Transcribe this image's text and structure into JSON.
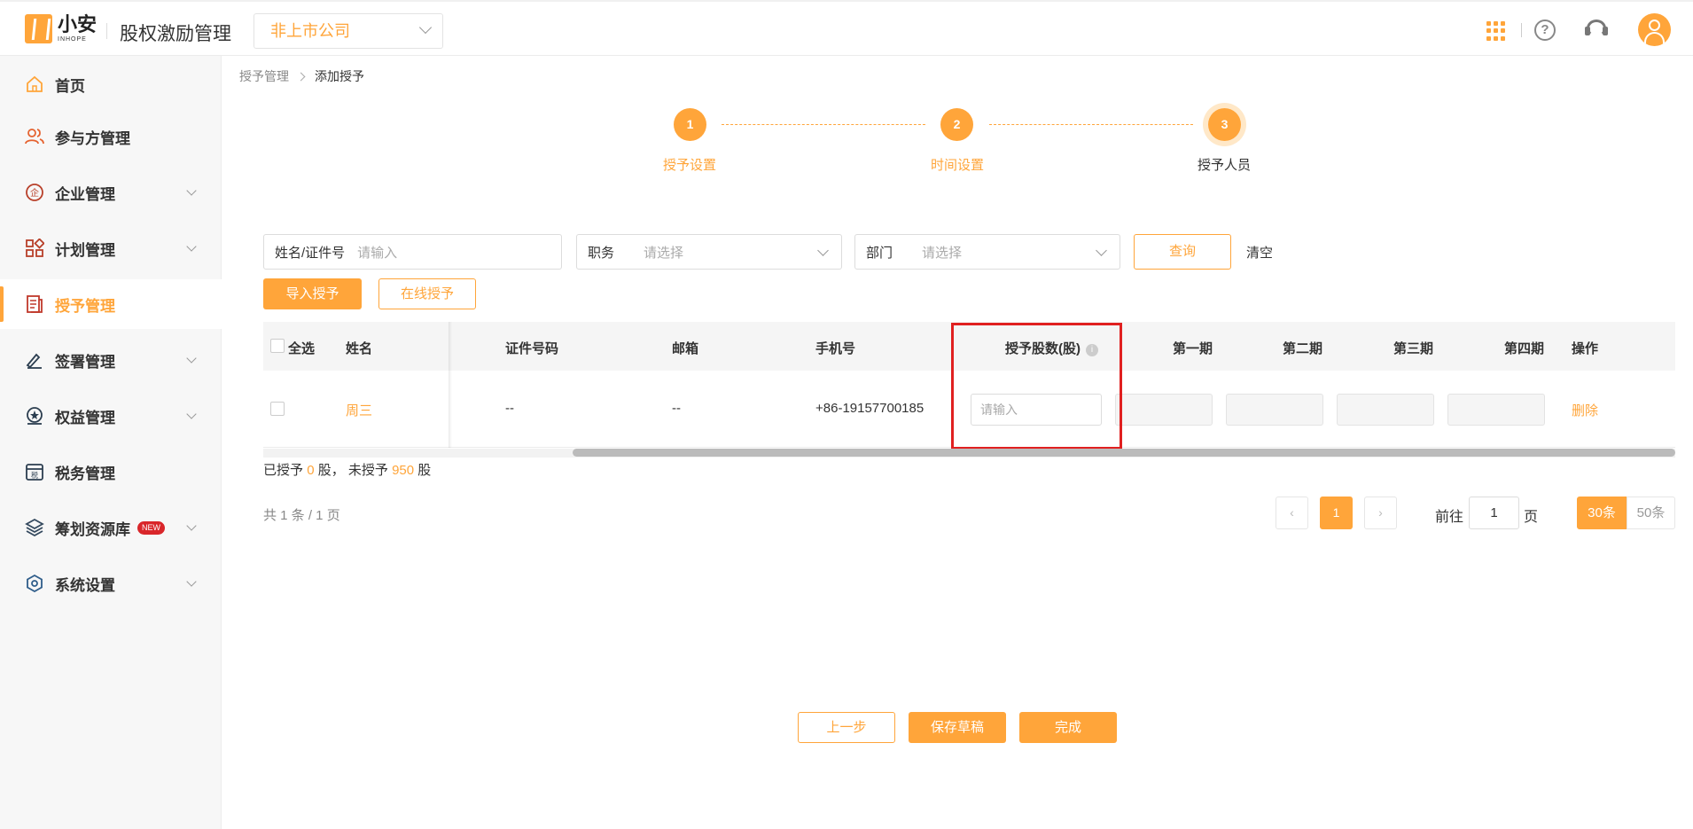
{
  "header": {
    "logo_cn": "小安",
    "logo_en": "INHOPE",
    "app_title": "股权激励管理",
    "company_select": "非上市公司"
  },
  "sidebar": {
    "items": [
      {
        "label": "首页",
        "icon": "home-icon"
      },
      {
        "label": "参与方管理",
        "icon": "users-icon"
      },
      {
        "label": "企业管理",
        "icon": "enterprise-icon"
      },
      {
        "label": "计划管理",
        "icon": "plan-icon"
      },
      {
        "label": "授予管理",
        "icon": "grant-icon"
      },
      {
        "label": "签署管理",
        "icon": "sign-icon"
      },
      {
        "label": "权益管理",
        "icon": "equity-icon"
      },
      {
        "label": "税务管理",
        "icon": "tax-icon"
      },
      {
        "label": "筹划资源库",
        "icon": "layers-icon",
        "badge": "NEW"
      },
      {
        "label": "系统设置",
        "icon": "settings-icon"
      }
    ]
  },
  "breadcrumb": {
    "parent": "授予管理",
    "current": "添加授予"
  },
  "steps": [
    {
      "num": "1",
      "label": "授予设置"
    },
    {
      "num": "2",
      "label": "时间设置"
    },
    {
      "num": "3",
      "label": "授予人员"
    }
  ],
  "filters": {
    "name_label": "姓名/证件号",
    "name_placeholder": "请输入",
    "position_label": "职务",
    "position_placeholder": "请选择",
    "dept_label": "部门",
    "dept_placeholder": "请选择",
    "query_button": "查询",
    "clear_link": "清空"
  },
  "actions": {
    "import_button": "导入授予",
    "online_button": "在线授予"
  },
  "table": {
    "columns": {
      "select_all": "全选",
      "name": "姓名",
      "id_number": "证件号码",
      "email": "邮箱",
      "phone": "手机号",
      "shares": "授予股数(股)",
      "period1": "第一期",
      "period2": "第二期",
      "period3": "第三期",
      "period4": "第四期",
      "operation": "操作"
    },
    "rows": [
      {
        "name": "周三",
        "id_number": "--",
        "email": "--",
        "phone": "+86-19157700185",
        "shares_placeholder": "请输入",
        "operation": "删除"
      }
    ]
  },
  "summary": {
    "granted_prefix": "已授予",
    "granted_value": "0",
    "granted_unit": "股，",
    "ungranted_prefix": "未授予",
    "ungranted_value": "950",
    "ungranted_unit": "股"
  },
  "pagination": {
    "total_text": "共 1 条 / 1 页",
    "current_page": "1",
    "goto_label": "前往",
    "goto_value": "1",
    "page_unit": "页",
    "size_30": "30条",
    "size_50": "50条"
  },
  "footer": {
    "prev_button": "上一步",
    "save_draft_button": "保存草稿",
    "finish_button": "完成"
  },
  "colors": {
    "accent": "#ffa53a",
    "highlight": "#e02020"
  }
}
